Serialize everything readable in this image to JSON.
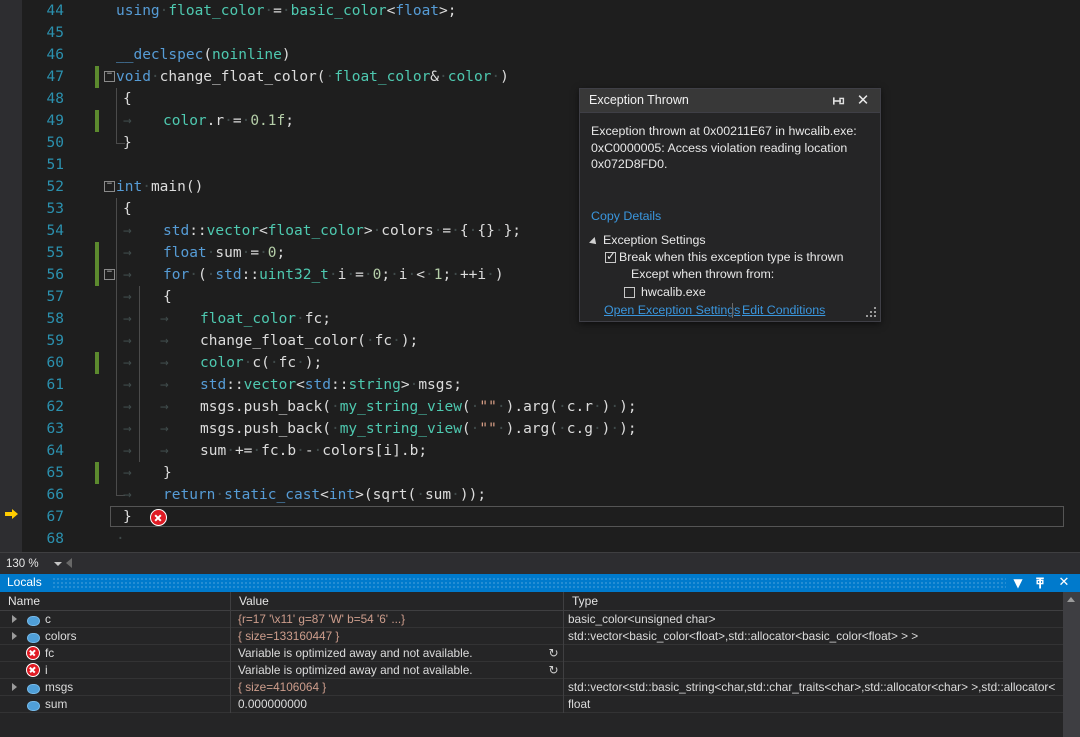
{
  "editor": {
    "first_line": 44,
    "zoom_level": "130 %",
    "current_line": 67,
    "lines": [
      {
        "n": 44,
        "text": "    using float_color = basic_color<float>;"
      },
      {
        "n": 45,
        "text": ""
      },
      {
        "n": 46,
        "text": "    __declspec(noinline)"
      },
      {
        "n": 47,
        "text": "void change_float_color( float_color& color )"
      },
      {
        "n": 48,
        "text": "{"
      },
      {
        "n": 49,
        "text": "    color.r = 0.1f;"
      },
      {
        "n": 50,
        "text": "}"
      },
      {
        "n": 51,
        "text": ""
      },
      {
        "n": 52,
        "text": "int main()"
      },
      {
        "n": 53,
        "text": "{"
      },
      {
        "n": 54,
        "text": "    std::vector<float_color> colors = { {} };"
      },
      {
        "n": 55,
        "text": "    float sum = 0;"
      },
      {
        "n": 56,
        "text": "    for ( std::uint32_t i = 0; i < 1; ++i )"
      },
      {
        "n": 57,
        "text": "    {"
      },
      {
        "n": 58,
        "text": "        float_color fc;"
      },
      {
        "n": 59,
        "text": "        change_float_color( fc );"
      },
      {
        "n": 60,
        "text": "        color c( fc );"
      },
      {
        "n": 61,
        "text": "        std::vector<std::string> msgs;"
      },
      {
        "n": 62,
        "text": "        msgs.push_back( my_string_view( \"\" ).arg( c.r ) );"
      },
      {
        "n": 63,
        "text": "        msgs.push_back( my_string_view( \"\" ).arg( c.g ) );"
      },
      {
        "n": 64,
        "text": "        sum += fc.b - colors[i].b;"
      },
      {
        "n": 65,
        "text": "    }"
      },
      {
        "n": 66,
        "text": "    return static_cast<int>(sqrt( sum ));"
      },
      {
        "n": 67,
        "text": "}"
      },
      {
        "n": 68,
        "text": ""
      }
    ]
  },
  "exception_dialog": {
    "title": "Exception Thrown",
    "message": "Exception thrown at 0x00211E67 in hwcalib.exe: 0xC0000005: Access violation reading location 0x072D8FD0.",
    "copy_details_label": "Copy Details",
    "settings_header": "Exception Settings",
    "break_checkbox_label": "Break when this exception type is thrown",
    "break_checked": true,
    "except_when_label": "Except when thrown from:",
    "module_checkbox_label": "hwcalib.exe",
    "module_checked": false,
    "open_settings_label": "Open Exception Settings",
    "edit_conditions_label": "Edit Conditions",
    "pin_icon": "pin-icon",
    "close_icon": "close-icon"
  },
  "locals": {
    "tab_label": "Locals",
    "dropdown_icon": "chevron-down-icon",
    "pin_icon": "pin-icon",
    "close_icon": "close-icon",
    "columns": [
      "Name",
      "Value",
      "Type"
    ],
    "rows": [
      {
        "name": "c",
        "value": "{r=17 '\\x11' g=87 'W' b=54 '6' ...}",
        "type": "basic_color<unsigned char>",
        "expandable": true,
        "error": false,
        "refresh": false
      },
      {
        "name": "colors",
        "value": "{ size=133160447 }",
        "type": "std::vector<basic_color<float>,std::allocator<basic_color<float> > >",
        "expandable": true,
        "error": false,
        "refresh": false
      },
      {
        "name": "fc",
        "value": "Variable is optimized away and not available.",
        "type": "",
        "expandable": false,
        "error": true,
        "refresh": true
      },
      {
        "name": "i",
        "value": "Variable is optimized away and not available.",
        "type": "",
        "expandable": false,
        "error": true,
        "refresh": true
      },
      {
        "name": "msgs",
        "value": "{ size=4106064 }",
        "type": "std::vector<std::basic_string<char,std::char_traits<char>,std::allocator<char> >,std::allocator<",
        "expandable": true,
        "error": false,
        "refresh": false
      },
      {
        "name": "sum",
        "value": "0.000000000",
        "type": "float",
        "expandable": false,
        "error": false,
        "refresh": false
      }
    ]
  },
  "colors": {
    "editor_bg": "#1e1e1e",
    "accent_blue": "#007acc",
    "link_blue": "#3a96dd",
    "keyword": "#569cd6",
    "type": "#4ec9b0",
    "string": "#d69d85",
    "number": "#b5cea8",
    "linenumber": "#2b91af",
    "changebar_green": "#5c8a2e",
    "error_red": "#e01b24",
    "current_arrow_yellow": "#ffcc00"
  }
}
